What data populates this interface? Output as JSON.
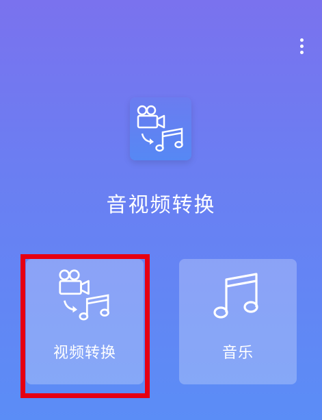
{
  "app": {
    "title": "音视频转换",
    "menu_icon": "more-vertical-icon",
    "logo_icon": "video-to-music-icon"
  },
  "tiles": [
    {
      "label": "视频转换",
      "icon": "video-to-music-icon"
    },
    {
      "label": "音乐",
      "icon": "music-note-icon"
    }
  ],
  "colors": {
    "background_top": "#7a72ee",
    "background_bottom": "#5b8df6",
    "highlight": "#e60012",
    "text": "#ffffff"
  }
}
